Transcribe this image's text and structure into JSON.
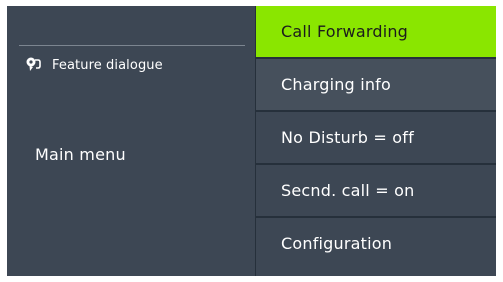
{
  "left": {
    "feature_label": "Feature dialogue",
    "main_menu_label": "Main menu",
    "feature_icon": "speech-bubble-icon"
  },
  "menu": {
    "items": [
      {
        "label": "Call Forwarding",
        "selected": true
      },
      {
        "label": "Charging info"
      },
      {
        "label": "No Disturb = off"
      },
      {
        "label": "Secnd. call = on"
      },
      {
        "label": "Configuration"
      }
    ]
  },
  "colors": {
    "background": "#3d4754",
    "selected": "#8ae600",
    "divider": "#26303b"
  }
}
